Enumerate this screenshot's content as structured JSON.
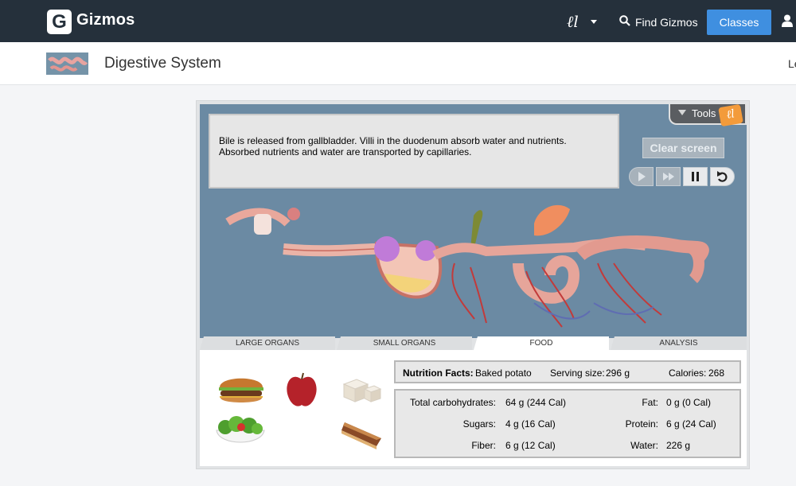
{
  "navbar": {
    "logo_letter": "G",
    "brand": "Gizmos",
    "el_menu_glyph": "ℓl",
    "find_gizmos": "Find Gizmos",
    "classes": "Classes",
    "colors": {
      "bg": "#25303b",
      "button": "#3f8fe0"
    }
  },
  "titlebar": {
    "title": "Digestive System",
    "right_cut_text": "Le"
  },
  "sim": {
    "message": "Bile is released from gallbladder. Villi in the duodenum absorb water and nutrients. Absorbed nutrients and water are transported by capillaries.",
    "tools_label": "Tools",
    "tools_badge": "ℓl",
    "clear_screen": "Clear screen",
    "controls": [
      "play",
      "fast-forward",
      "pause",
      "reset"
    ]
  },
  "tabs": [
    "LARGE ORGANS",
    "SMALL ORGANS",
    "FOOD",
    "ANALYSIS"
  ],
  "active_tab": "FOOD",
  "foods": [
    "hamburger",
    "apple",
    "tofu",
    "salad",
    "pie"
  ],
  "nutrition": {
    "heading": "Nutrition Facts:",
    "food": "Baked potato",
    "serving_label": "Serving size:",
    "serving_value": "296 g",
    "calories_label": "Calories:",
    "calories_value": "268",
    "rows": [
      {
        "label": "Total carbohydrates:",
        "value": "64 g (244 Cal)",
        "label2": "Fat:",
        "value2": "0 g (0 Cal)"
      },
      {
        "label": "Sugars:",
        "value": "4 g (16 Cal)",
        "label2": "Protein:",
        "value2": "6 g (24 Cal)"
      },
      {
        "label": "Fiber:",
        "value": "6 g (12 Cal)",
        "label2": "Water:",
        "value2": "226 g"
      }
    ]
  }
}
